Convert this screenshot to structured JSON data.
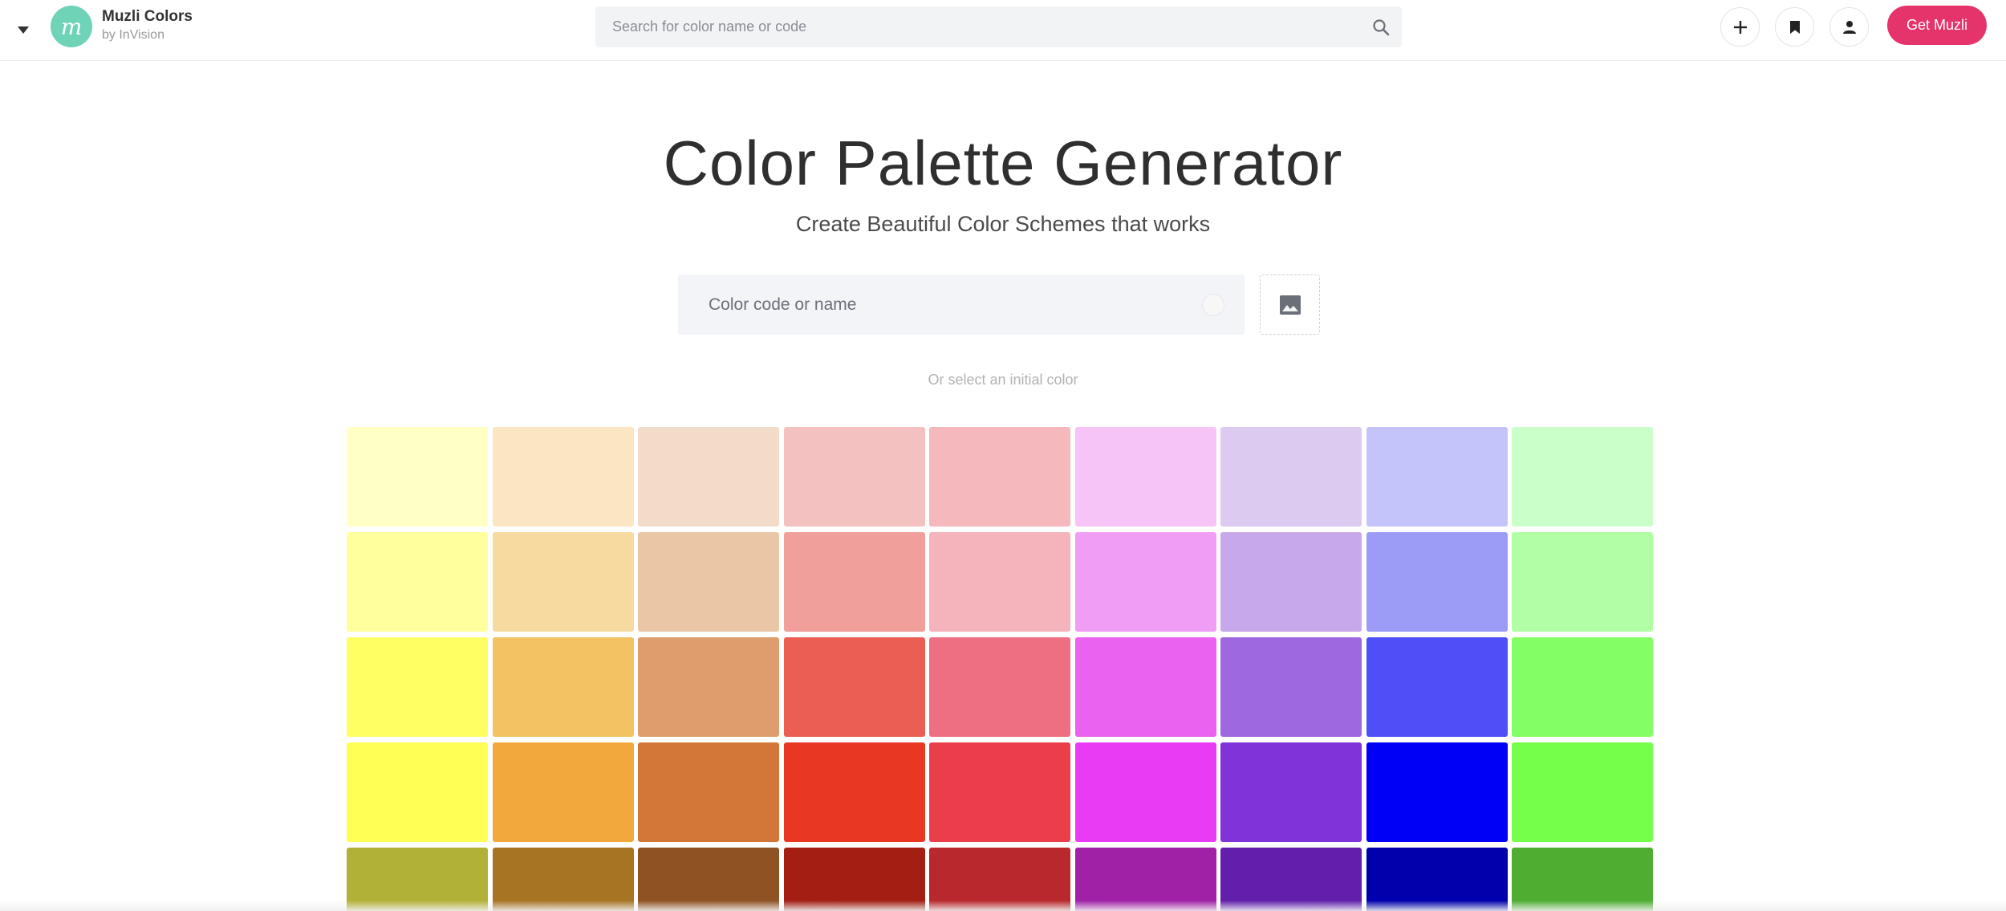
{
  "header": {
    "brand_name": "Muzli Colors",
    "brand_sub": "by InVision",
    "logo_letter": "m",
    "search_placeholder": "Search for color name or code",
    "get_button": "Get Muzli",
    "accent_color": "#e5346b",
    "logo_color": "#6fd3b8"
  },
  "hero": {
    "title": "Color Palette Generator",
    "subtitle": "Create Beautiful Color Schemes that works",
    "input_placeholder": "Color code or name",
    "hint": "Or select an initial color"
  },
  "swatches": [
    [
      "#ffffc6",
      "#fbe5c3",
      "#f3dbca",
      "#f4c1c1",
      "#f4b8bd",
      "#f6c4f7",
      "#dccaf1",
      "#c4c4fa",
      "#cbffca"
    ],
    [
      "#ffff9d",
      "#f7da9f",
      "#eac6a7",
      "#f09f9b",
      "#f5b3bc",
      "#f09ef5",
      "#c7a8eb",
      "#9c9cf7",
      "#b1fea4"
    ],
    [
      "#ffff64",
      "#f3c263",
      "#df9d6d",
      "#ea5e53",
      "#ee6f82",
      "#ea62f0",
      "#9e68e1",
      "#4e4ff7",
      "#84fe65"
    ],
    [
      "#ffff55",
      "#f2a83d",
      "#d27737",
      "#e83822",
      "#ea3e4a",
      "#e93bf3",
      "#7f33d8",
      "#0000f7",
      "#75fe4a"
    ],
    [
      "#b2b137",
      "#a77424",
      "#8f5222",
      "#a31f14",
      "#b8282c",
      "#a020a6",
      "#621fac",
      "#0000ad",
      "#4fad32"
    ]
  ],
  "icons": {
    "menu": "caret-down-icon",
    "search": "search-icon",
    "add": "plus-icon",
    "bookmark": "bookmark-icon",
    "user": "user-icon",
    "image": "image-icon"
  }
}
